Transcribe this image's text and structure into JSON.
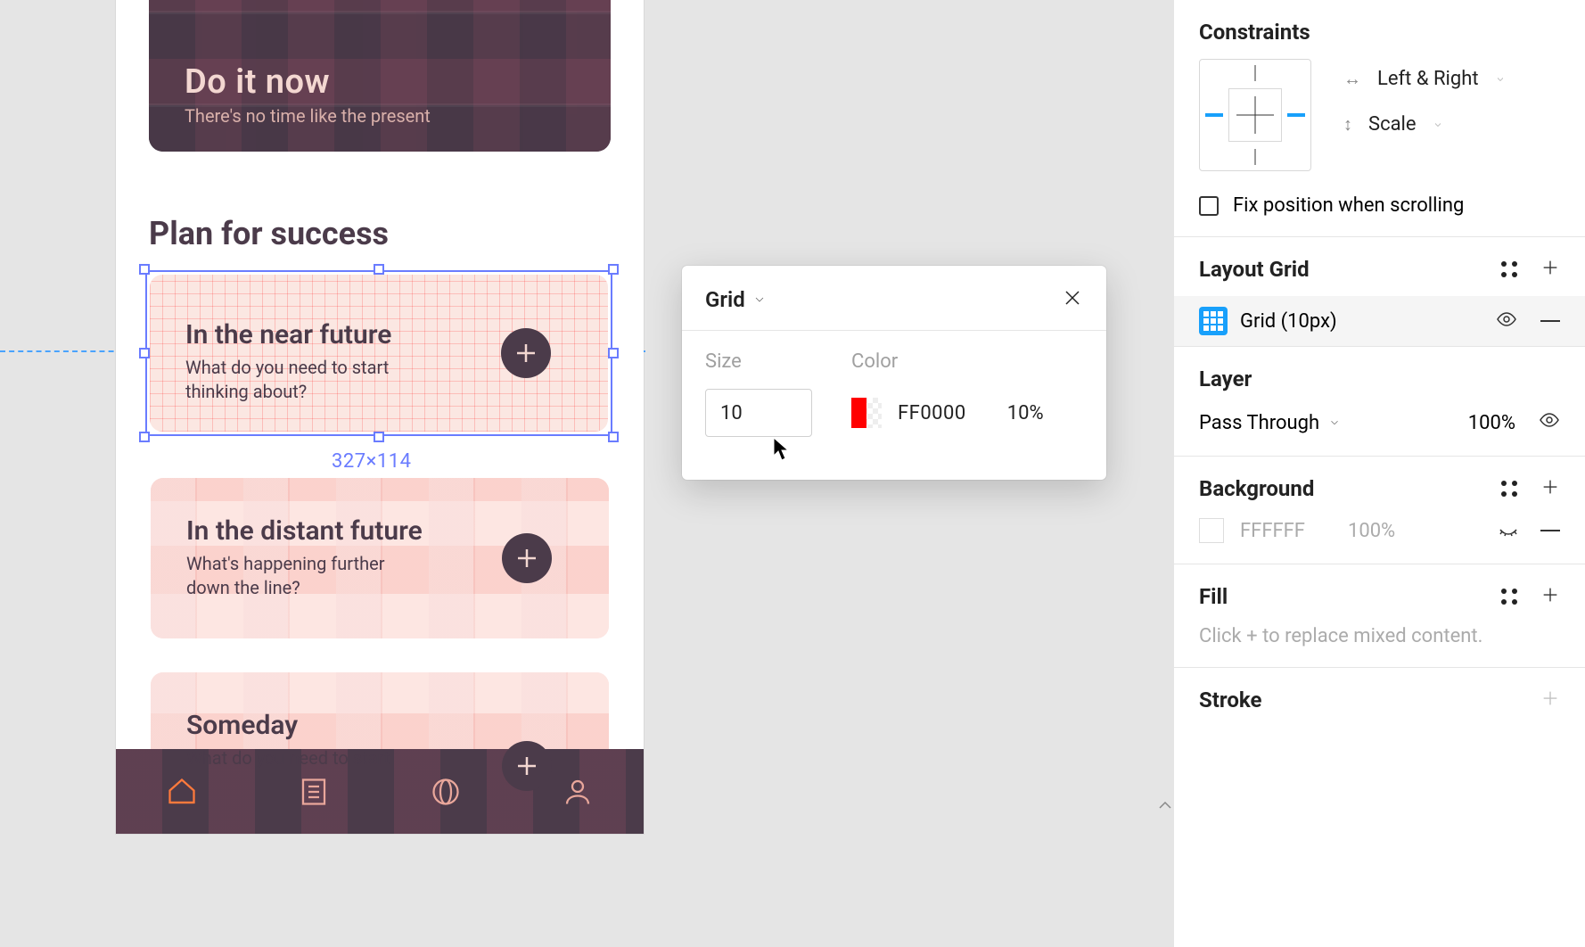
{
  "canvas": {
    "hero": {
      "title": "Do it now",
      "subtitle": "There's no time like the present"
    },
    "section_title": "Plan for success",
    "selected_card": {
      "title": "In the near future",
      "subtitle": "What do you need to start thinking about?"
    },
    "card2": {
      "title": "In the distant future",
      "subtitle": "What's happening further down the line?"
    },
    "card3": {
      "title": "Someday",
      "subtitle": "What do you need to start"
    },
    "selection_dimensions": "327×114"
  },
  "grid_popup": {
    "title": "Grid",
    "size_label": "Size",
    "size_value": "10",
    "color_label": "Color",
    "color_hex": "FF0000",
    "color_opacity": "10%"
  },
  "inspector": {
    "constraints": {
      "title": "Constraints",
      "horizontal": "Left & Right",
      "vertical": "Scale",
      "fix_label": "Fix position when scrolling"
    },
    "layout_grid": {
      "title": "Layout Grid",
      "item_label": "Grid (10px)"
    },
    "layer": {
      "title": "Layer",
      "blend": "Pass Through",
      "opacity": "100%"
    },
    "background": {
      "title": "Background",
      "hex": "FFFFFF",
      "opacity": "100%"
    },
    "fill": {
      "title": "Fill",
      "placeholder": "Click + to replace mixed content."
    },
    "stroke": {
      "title": "Stroke"
    }
  }
}
